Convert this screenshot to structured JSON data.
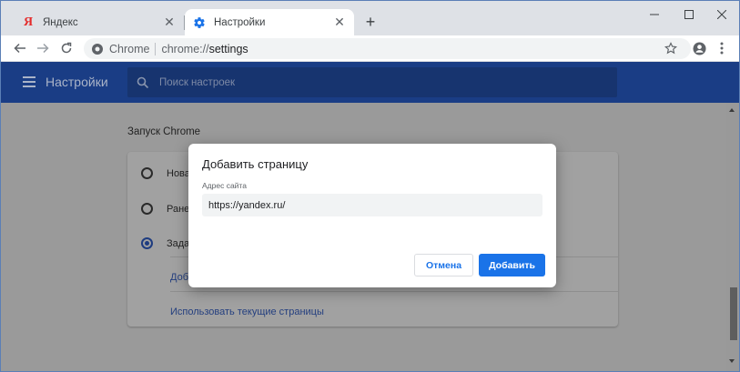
{
  "tabs": [
    {
      "title": "Яндекс",
      "icon": "yandex-icon",
      "active": false
    },
    {
      "title": "Настройки",
      "icon": "settings-gear-icon",
      "active": true
    }
  ],
  "window_controls": {
    "minimize": "minimize-icon",
    "maximize": "maximize-icon",
    "close": "close-icon"
  },
  "omnibox": {
    "chip": "Chrome",
    "url_scheme": "chrome://",
    "url_path": "settings"
  },
  "settings_header": {
    "title": "Настройки",
    "search_placeholder": "Поиск настроек"
  },
  "content": {
    "section_title": "Запуск Chrome",
    "options": [
      {
        "label": "Нова",
        "selected": false
      },
      {
        "label": "Ране",
        "selected": false
      },
      {
        "label": "Зада",
        "selected": true
      }
    ],
    "add_page_link": "Доб",
    "use_current_link": "Использовать текущие страницы"
  },
  "dialog": {
    "title": "Добавить страницу",
    "field_label": "Адрес сайта",
    "field_value": "https://yandex.ru/",
    "cancel_label": "Отмена",
    "add_label": "Добавить"
  },
  "colors": {
    "header": "#1a3d85",
    "accent": "#1a73e8",
    "yandex": "#e42c2c"
  }
}
